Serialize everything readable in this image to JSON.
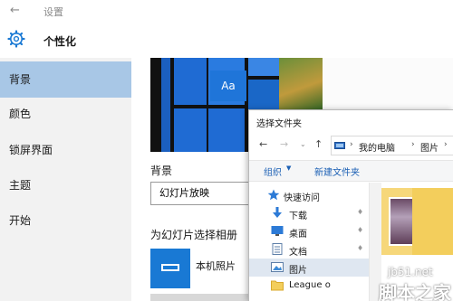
{
  "window": {
    "title": "设置"
  },
  "header": {
    "section_title": "个性化"
  },
  "sidebar": {
    "items": [
      {
        "label": "背景",
        "active": true
      },
      {
        "label": "颜色",
        "active": false
      },
      {
        "label": "锁屏界面",
        "active": false
      },
      {
        "label": "主题",
        "active": false
      },
      {
        "label": "开始",
        "active": false
      }
    ]
  },
  "preview": {
    "tile_text": "Aa"
  },
  "background": {
    "label": "背景",
    "selected_value": "幻灯片放映",
    "album_label": "为幻灯片选择相册",
    "album_item": "本机照片"
  },
  "dialog": {
    "title": "选择文件夹",
    "breadcrumb": [
      "我的电脑",
      "图片"
    ],
    "organize_label": "组织",
    "new_folder_label": "新建文件夹",
    "nav": [
      {
        "label": "快速访问",
        "icon": "star-icon",
        "pinned": false,
        "selected": false
      },
      {
        "label": "下载",
        "icon": "download-icon",
        "pinned": true,
        "selected": false
      },
      {
        "label": "桌面",
        "icon": "desktop-icon",
        "pinned": true,
        "selected": false
      },
      {
        "label": "文档",
        "icon": "document-icon",
        "pinned": true,
        "selected": false
      },
      {
        "label": "图片",
        "icon": "pictures-icon",
        "pinned": false,
        "selected": true
      },
      {
        "label": "League o",
        "icon": "folder-icon",
        "pinned": false,
        "selected": false
      }
    ]
  },
  "watermark": {
    "url": "jb51.net",
    "name": "脚本之家"
  },
  "colors": {
    "accent": "#1979d4",
    "sidebar_active": "#a8c7e6",
    "sidebar_bg": "#f2f2f2",
    "folder": "#f3ce5c"
  }
}
